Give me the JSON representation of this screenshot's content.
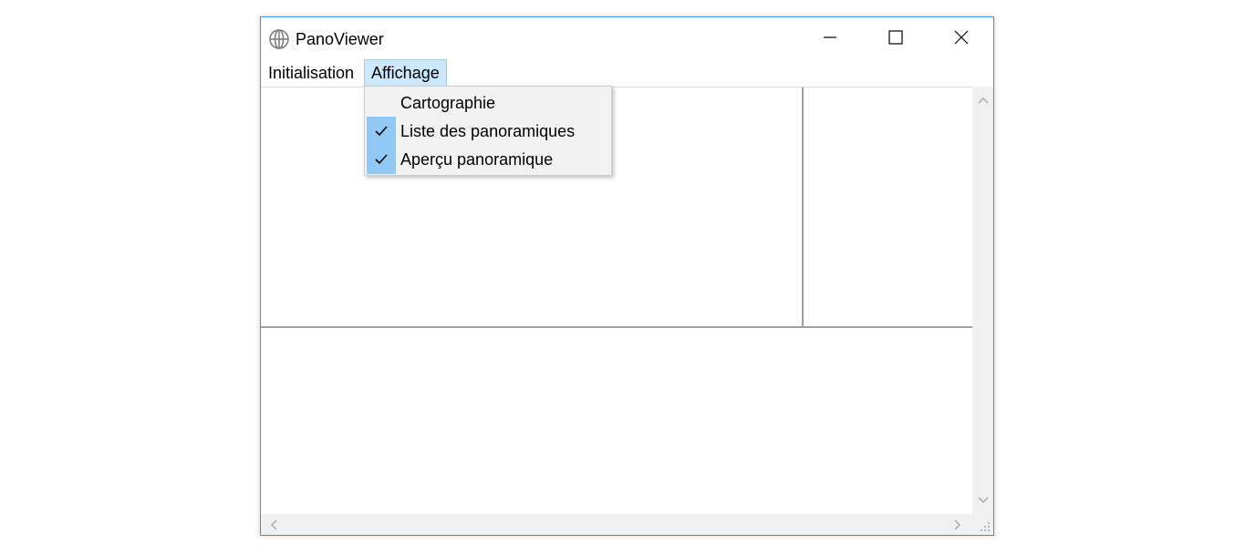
{
  "window": {
    "title": "PanoViewer",
    "app_icon": "globe-icon"
  },
  "window_controls": {
    "minimize_icon": "minimize-icon",
    "maximize_icon": "maximize-icon",
    "close_icon": "close-icon"
  },
  "menubar": {
    "items": [
      {
        "label": "Initialisation"
      },
      {
        "label": "Affichage",
        "state": "open"
      }
    ]
  },
  "dropdown": {
    "items": [
      {
        "label": "Cartographie",
        "checked": false
      },
      {
        "label": "Liste des panoramiques",
        "checked": true
      },
      {
        "label": "Aperçu panoramique",
        "checked": true
      }
    ]
  },
  "colors": {
    "window_border": "#4a8fc6",
    "menu_highlight": "#cce8ff",
    "check_highlight": "#90c8f6",
    "splitter": "#a0a0a0",
    "scrollbar": "#f0f0f0"
  }
}
